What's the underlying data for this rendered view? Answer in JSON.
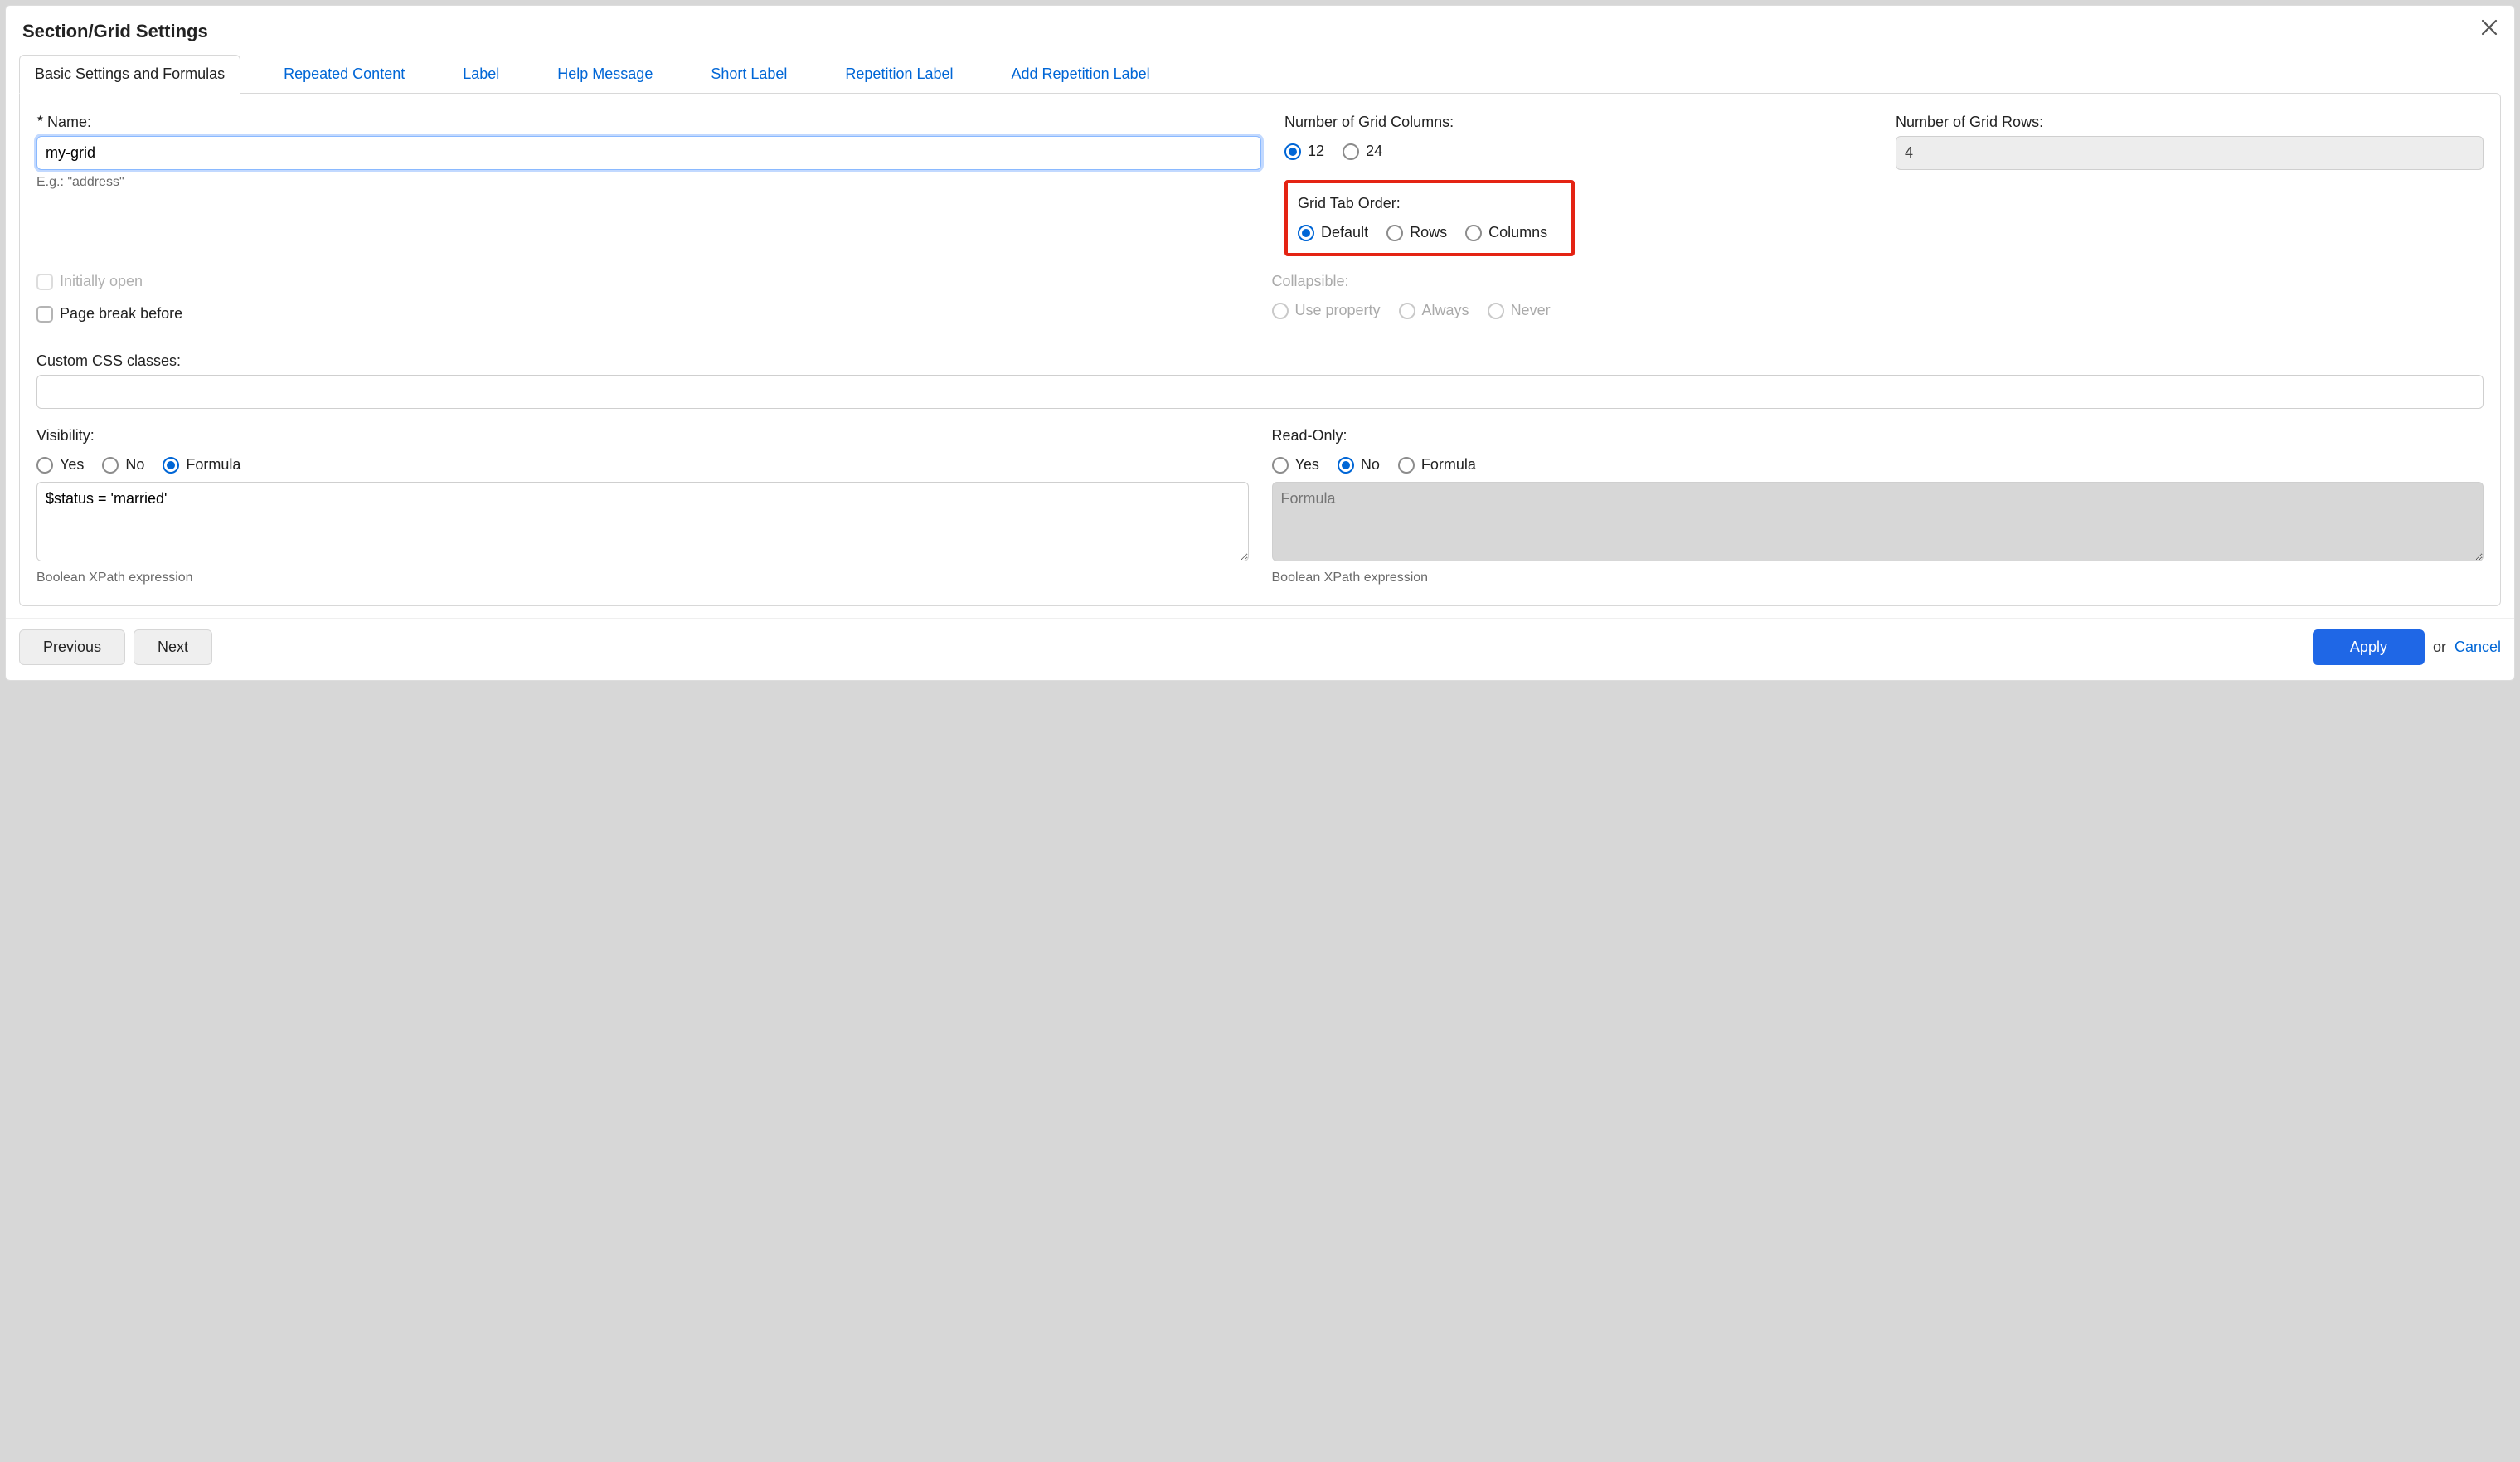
{
  "dialog": {
    "title": "Section/Grid Settings"
  },
  "tabs": {
    "basic": "Basic Settings and Formulas",
    "repeated": "Repeated Content",
    "label": "Label",
    "help": "Help Message",
    "short": "Short Label",
    "repetition": "Repetition Label",
    "addrep": "Add Repetition Label"
  },
  "name": {
    "label": "Name:",
    "value": "my-grid",
    "hint": "E.g.: \"address\""
  },
  "columns": {
    "label": "Number of Grid Columns:",
    "opt12": "12",
    "opt24": "24"
  },
  "rows": {
    "label": "Number of Grid Rows:",
    "value": "4"
  },
  "taborder": {
    "label": "Grid Tab Order:",
    "default": "Default",
    "rows": "Rows",
    "columns": "Columns"
  },
  "initially_open": "Initially open",
  "page_break": "Page break before",
  "collapsible": {
    "label": "Collapsible:",
    "prop": "Use property",
    "always": "Always",
    "never": "Never"
  },
  "css": {
    "label": "Custom CSS classes:",
    "value": ""
  },
  "visibility": {
    "label": "Visibility:",
    "yes": "Yes",
    "no": "No",
    "formula": "Formula",
    "expr": "$status = 'married'",
    "hint": "Boolean XPath expression"
  },
  "readonly": {
    "label": "Read-Only:",
    "yes": "Yes",
    "no": "No",
    "formula": "Formula",
    "placeholder": "Formula",
    "hint": "Boolean XPath expression"
  },
  "footer": {
    "previous": "Previous",
    "next": "Next",
    "apply": "Apply",
    "or": "or",
    "cancel": "Cancel"
  }
}
